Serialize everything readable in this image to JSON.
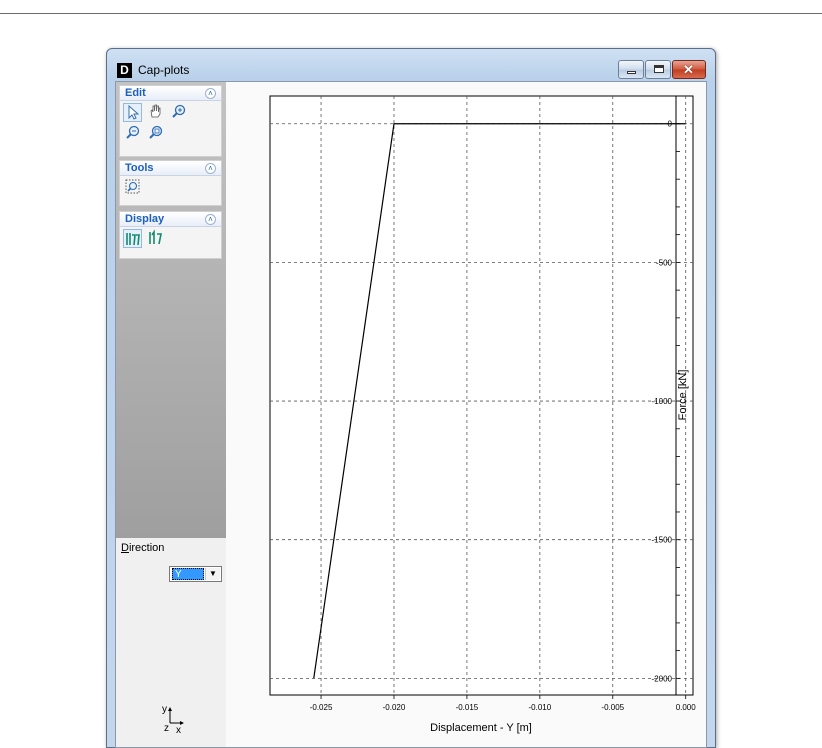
{
  "window": {
    "title": "Cap-plots",
    "logo_letter": "D",
    "close_glyph": "✕"
  },
  "panels": {
    "edit": {
      "title": "Edit",
      "tools": [
        "select-arrow",
        "pan-hand",
        "zoom-in",
        "zoom-out",
        "zoom-extents"
      ]
    },
    "tools": {
      "title": "Tools",
      "tools": [
        "zoom-window"
      ]
    },
    "display": {
      "title": "Display",
      "tools": [
        "display-values",
        "display-lines"
      ]
    }
  },
  "direction": {
    "label_prefix": "D",
    "label_rest": "irection",
    "value": "Y"
  },
  "axes_icon": {
    "y": "y",
    "z": "z",
    "x": "x"
  },
  "chart_data": {
    "type": "line",
    "xlabel": "Displacement - Y [m]",
    "ylabel": "Force [kN]",
    "xlim": [
      -0.0285,
      0.0005
    ],
    "ylim": [
      -2060,
      100
    ],
    "x_ticks": [
      -0.025,
      -0.02,
      -0.015,
      -0.01,
      -0.005,
      0.0
    ],
    "x_tick_labels": [
      "-0.025",
      "-0.020",
      "-0.015",
      "-0.010",
      "-0.005",
      "0.000"
    ],
    "y_ticks": [
      0,
      -500,
      -1000,
      -1500,
      -2000
    ],
    "y_tick_labels": [
      "0",
      "-500",
      "-1000",
      "-1500",
      "-2000"
    ],
    "grid": true,
    "series": [
      {
        "x": [
          -0.0255,
          -0.02,
          0.0
        ],
        "y": [
          -2000,
          0,
          0
        ],
        "color": "#000000"
      }
    ]
  }
}
